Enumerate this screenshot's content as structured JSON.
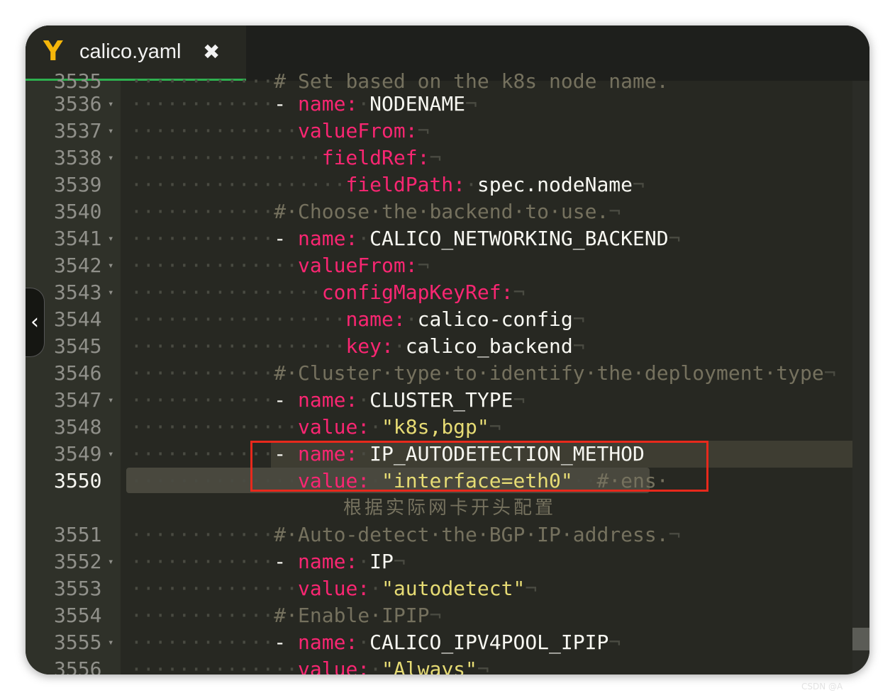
{
  "tab": {
    "icon": "Y",
    "title": "calico.yaml",
    "close": "✖"
  },
  "annotation": "根据实际网卡开头配置",
  "watermark": "CSDN @A",
  "lines": [
    {
      "n": "3535",
      "fold": false,
      "top_cut": true,
      "parts": [
        [
          "inv",
          "············"
        ],
        [
          "com",
          "# Set based on the k8s node name."
        ]
      ]
    },
    {
      "n": "3536",
      "fold": true,
      "parts": [
        [
          "inv",
          "············"
        ],
        [
          "dash",
          "- "
        ],
        [
          "key",
          "name:"
        ],
        [
          "inv",
          "·"
        ],
        [
          "txt",
          "NODENAME"
        ],
        [
          "inv",
          "¬"
        ]
      ]
    },
    {
      "n": "3537",
      "fold": true,
      "parts": [
        [
          "inv",
          "··············"
        ],
        [
          "key",
          "valueFrom:"
        ],
        [
          "inv",
          "¬"
        ]
      ]
    },
    {
      "n": "3538",
      "fold": true,
      "parts": [
        [
          "inv",
          "················"
        ],
        [
          "key",
          "fieldRef:"
        ],
        [
          "inv",
          "¬"
        ]
      ]
    },
    {
      "n": "3539",
      "fold": false,
      "parts": [
        [
          "inv",
          "··················"
        ],
        [
          "key",
          "fieldPath:"
        ],
        [
          "inv",
          "·"
        ],
        [
          "txt",
          "spec.nodeName"
        ],
        [
          "inv",
          "¬"
        ]
      ]
    },
    {
      "n": "3540",
      "fold": false,
      "parts": [
        [
          "inv",
          "············"
        ],
        [
          "com",
          "#·Choose·the·backend·to·use."
        ],
        [
          "inv",
          "¬"
        ]
      ]
    },
    {
      "n": "3541",
      "fold": true,
      "parts": [
        [
          "inv",
          "············"
        ],
        [
          "dash",
          "- "
        ],
        [
          "key",
          "name:"
        ],
        [
          "inv",
          "·"
        ],
        [
          "txt",
          "CALICO_NETWORKING_BACKEND"
        ],
        [
          "inv",
          "¬"
        ]
      ]
    },
    {
      "n": "3542",
      "fold": true,
      "parts": [
        [
          "inv",
          "··············"
        ],
        [
          "key",
          "valueFrom:"
        ],
        [
          "inv",
          "¬"
        ]
      ]
    },
    {
      "n": "3543",
      "fold": true,
      "parts": [
        [
          "inv",
          "················"
        ],
        [
          "key",
          "configMapKeyRef:"
        ],
        [
          "inv",
          "¬"
        ]
      ]
    },
    {
      "n": "3544",
      "fold": false,
      "parts": [
        [
          "inv",
          "··················"
        ],
        [
          "key",
          "name:"
        ],
        [
          "inv",
          "·"
        ],
        [
          "txt",
          "calico-config"
        ],
        [
          "inv",
          "¬"
        ]
      ]
    },
    {
      "n": "3545",
      "fold": false,
      "parts": [
        [
          "inv",
          "··················"
        ],
        [
          "key",
          "key:"
        ],
        [
          "inv",
          "·"
        ],
        [
          "txt",
          "calico_backend"
        ],
        [
          "inv",
          "¬"
        ]
      ]
    },
    {
      "n": "3546",
      "fold": false,
      "parts": [
        [
          "inv",
          "············"
        ],
        [
          "com",
          "#·Cluster·type·to·identify·the·deployment·type"
        ],
        [
          "inv",
          "¬"
        ]
      ]
    },
    {
      "n": "3547",
      "fold": true,
      "parts": [
        [
          "inv",
          "············"
        ],
        [
          "dash",
          "- "
        ],
        [
          "key",
          "name:"
        ],
        [
          "inv",
          "·"
        ],
        [
          "txt",
          "CLUSTER_TYPE"
        ],
        [
          "inv",
          "¬"
        ]
      ]
    },
    {
      "n": "3548",
      "fold": false,
      "parts": [
        [
          "inv",
          "··············"
        ],
        [
          "key",
          "value:"
        ],
        [
          "inv",
          "·"
        ],
        [
          "str",
          "\"k8s,bgp\""
        ],
        [
          "inv",
          "¬"
        ]
      ]
    },
    {
      "n": "3549",
      "fold": true,
      "parts": [
        [
          "inv",
          "············"
        ],
        [
          "dash",
          "- "
        ],
        [
          "key",
          "name:"
        ],
        [
          "inv",
          "·"
        ],
        [
          "txt",
          "IP_AUTODETECTION_METHOD"
        ]
      ]
    },
    {
      "n": "3550",
      "fold": false,
      "parts": [
        [
          "inv",
          "··············"
        ],
        [
          "key",
          "value:"
        ],
        [
          "inv",
          "·"
        ],
        [
          "str",
          "\"interface=eth0\""
        ],
        [
          "inv",
          "··"
        ],
        [
          "com",
          "#·ens·"
        ]
      ]
    },
    {
      "n": "3551",
      "fold": false,
      "parts": [
        [
          "inv",
          "············"
        ],
        [
          "com",
          "#·Auto-detect·the·BGP·IP·address."
        ],
        [
          "inv",
          "¬"
        ]
      ]
    },
    {
      "n": "3552",
      "fold": true,
      "parts": [
        [
          "inv",
          "············"
        ],
        [
          "dash",
          "- "
        ],
        [
          "key",
          "name:"
        ],
        [
          "inv",
          "·"
        ],
        [
          "txt",
          "IP"
        ],
        [
          "inv",
          "¬"
        ]
      ]
    },
    {
      "n": "3553",
      "fold": false,
      "parts": [
        [
          "inv",
          "··············"
        ],
        [
          "key",
          "value:"
        ],
        [
          "inv",
          "·"
        ],
        [
          "str",
          "\"autodetect\""
        ],
        [
          "inv",
          "¬"
        ]
      ]
    },
    {
      "n": "3554",
      "fold": false,
      "parts": [
        [
          "inv",
          "············"
        ],
        [
          "com",
          "#·Enable·IPIP"
        ],
        [
          "inv",
          "¬"
        ]
      ]
    },
    {
      "n": "3555",
      "fold": true,
      "parts": [
        [
          "inv",
          "············"
        ],
        [
          "dash",
          "- "
        ],
        [
          "key",
          "name:"
        ],
        [
          "inv",
          "·"
        ],
        [
          "txt",
          "CALICO_IPV4POOL_IPIP"
        ],
        [
          "inv",
          "¬"
        ]
      ]
    },
    {
      "n": "3556",
      "fold": false,
      "parts": [
        [
          "inv",
          "··············"
        ],
        [
          "key",
          "value:"
        ],
        [
          "inv",
          "·"
        ],
        [
          "str",
          "\"Always\""
        ],
        [
          "inv",
          "¬"
        ]
      ]
    }
  ]
}
